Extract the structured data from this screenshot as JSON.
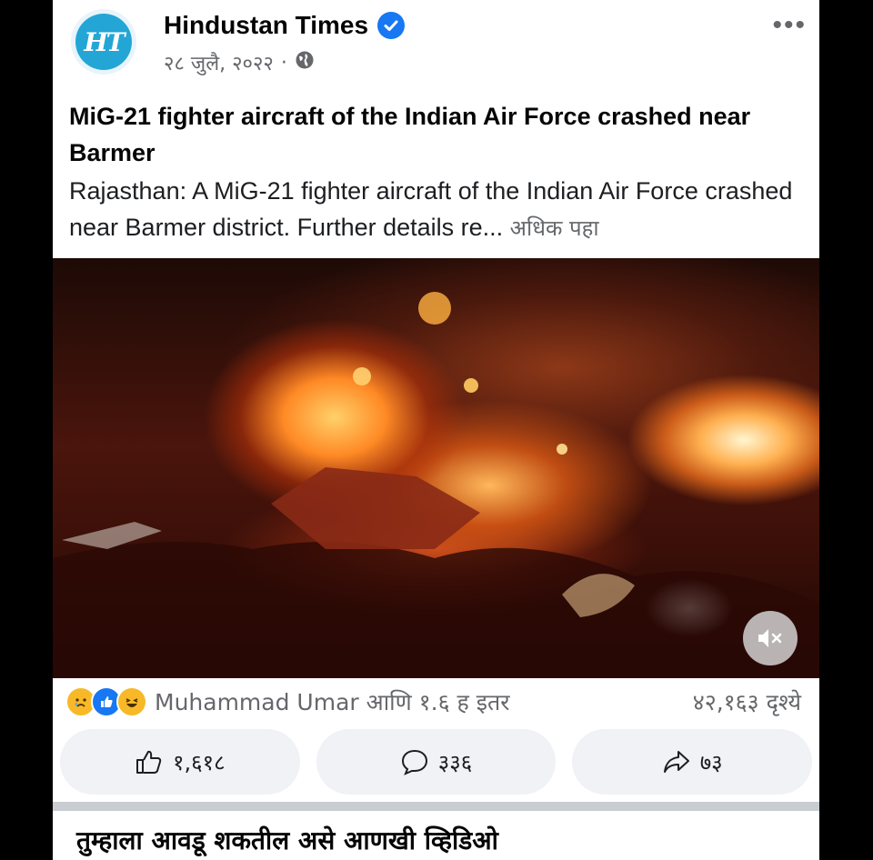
{
  "post": {
    "page_name": "Hindustan Times",
    "logo_text": "HT",
    "date": "२८ जुलै, २०२२",
    "separator": "·",
    "privacy_icon": "globe-icon",
    "more_label": "•••",
    "title": "MiG-21 fighter aircraft of the Indian Air Force crashed near Barmer",
    "description": "Rajasthan: A MiG-21 fighter aircraft of the Indian Air Force crashed near Barmer district. Further details re...",
    "see_more": "अधिक पहा"
  },
  "video": {
    "mute_icon": "volume-muted-icon"
  },
  "reactions": {
    "icons": [
      "sad-reaction-icon",
      "like-reaction-icon",
      "haha-reaction-icon"
    ],
    "summary": "Muhammad Umar आणि १.६ ह इतर",
    "views": "४२,१६३ दृश्ये"
  },
  "actions": {
    "like_count": "१,६१८",
    "comment_count": "३३६",
    "share_count": "७३"
  },
  "suggestions": {
    "heading": "तुम्हाला आवडू शकतील असे आणखी व्हिडिओ"
  },
  "colors": {
    "brand_blue": "#1877f2",
    "ht_logo": "#23a6d6",
    "secondary_text": "#65676b",
    "button_bg": "#f0f2f5"
  }
}
